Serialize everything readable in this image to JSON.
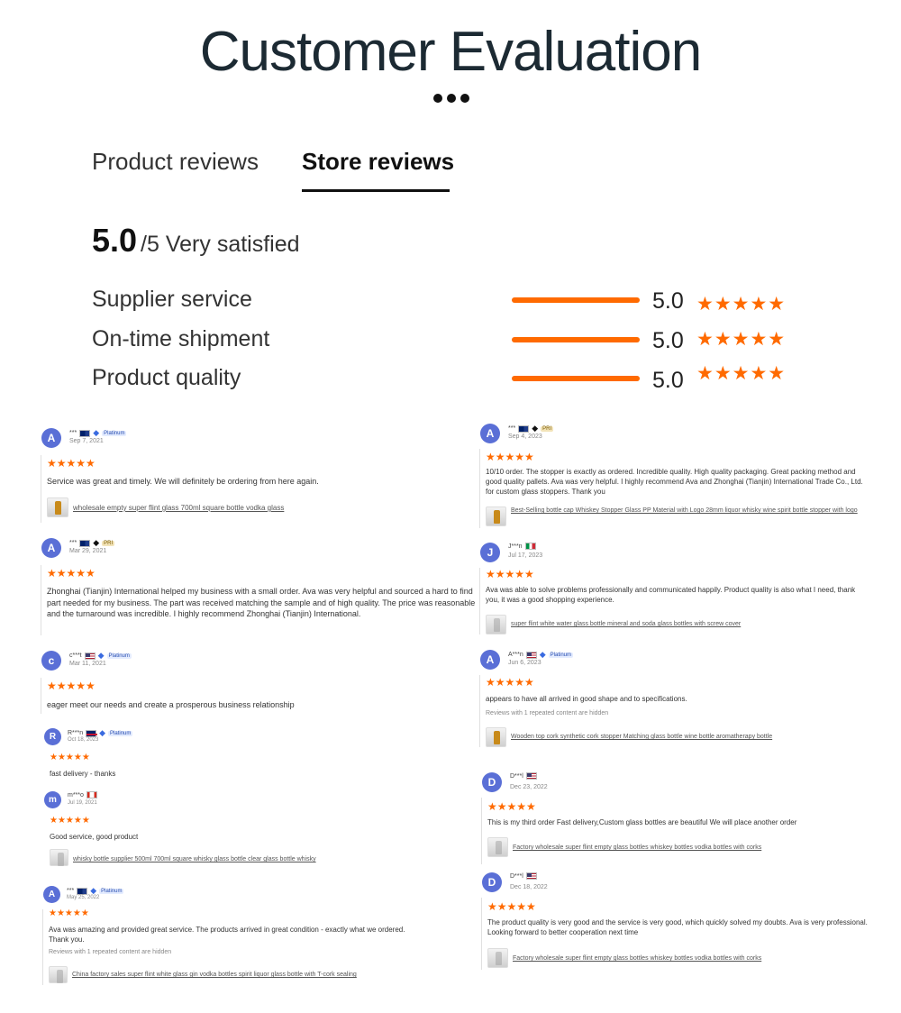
{
  "header": {
    "title": "Customer Evaluation"
  },
  "tabs": [
    {
      "label": "Product reviews"
    },
    {
      "label": "Store reviews"
    }
  ],
  "overall": {
    "score": "5.0",
    "suffix": "/5 Very satisfied"
  },
  "metrics": [
    {
      "label": "Supplier service",
      "value": "5.0",
      "fill_percent": 100,
      "stars": "★★★★★"
    },
    {
      "label": "On-time shipment",
      "value": "5.0",
      "fill_percent": 100,
      "stars": "★★★★★"
    },
    {
      "label": "Product quality",
      "value": "5.0",
      "fill_percent": 100,
      "stars": "★★★★★"
    }
  ],
  "colors": {
    "accent": "#ff6a00",
    "avatar": "#5a6fd6",
    "title": "#1c2a33"
  },
  "reviews_left": [
    {
      "initial": "A",
      "name": "***",
      "flag": "au",
      "badge": "Platinum",
      "date": "Sep 7, 2021",
      "stars": "★★★★★",
      "text": "Service was great and timely. We will definitely be ordering from here again.",
      "product": "wholesale empty super flint glass 700ml square bottle vodka glass"
    },
    {
      "initial": "A",
      "name": "***",
      "flag": "au",
      "badge": "PRI",
      "date": "Mar 29, 2021",
      "stars": "★★★★★",
      "text": "Zhonghai (Tianjin) International helped my business with a small order. Ava was very helpful and sourced a hard to find part needed for my business. The part was received matching the sample and of high quality. The price was reasonable and the turnaround was incredible. I highly recommend Zhonghai (Tianjin) International."
    },
    {
      "initial": "c",
      "name": "c***t",
      "flag": "us",
      "badge": "Platinum",
      "date": "Mar 11, 2021",
      "stars": "★★★★★",
      "text": "eager meet our needs and create a prosperous business relationship"
    },
    {
      "initial": "R",
      "name": "R***n",
      "flag": "gb",
      "badge": "Platinum",
      "date": "Oct 18, 2023",
      "stars": "★★★★★",
      "text": "fast delivery - thanks"
    },
    {
      "initial": "m",
      "name": "m***o",
      "flag": "ca",
      "badge": "",
      "date": "Jul 19, 2021",
      "stars": "★★★★★",
      "text": "Good service, good product",
      "product": "whisky bottle supplier 500ml 700ml square whisky glass bottle clear glass bottle whisky"
    },
    {
      "initial": "A",
      "name": "***",
      "flag": "au",
      "badge": "Platinum",
      "date": "May 25, 2022",
      "stars": "★★★★★",
      "text": "Ava was amazing and provided great service. The products arrived in great condition - exactly what we ordered. Thank you.",
      "hidden_note": "Reviews with 1 repeated content are hidden",
      "product": "China factory sales super flint white glass gin vodka bottles spirit liquor glass bottle with T-cork sealing"
    }
  ],
  "reviews_right": [
    {
      "initial": "A",
      "name": "***",
      "flag": "au",
      "badge": "PRI",
      "date": "Sep 4, 2023",
      "stars": "★★★★★",
      "text": "10/10 order. The stopper is exactly as ordered. Incredible quality. High quality packaging. Great packing method and good quality pallets. Ava was very helpful. I highly recommend Ava and Zhonghai (Tianjin) International Trade Co., Ltd. for custom glass stoppers. Thank you",
      "product": "Best-Selling bottle cap Whiskey Stopper Glass PP Material with Logo 28mm liquor whisky wine spirit bottle stopper with logo"
    },
    {
      "initial": "J",
      "name": "J***n",
      "flag": "it",
      "badge": "",
      "date": "Jul 17, 2023",
      "stars": "★★★★★",
      "text": "Ava was able to solve problems professionally and communicated happily. Product quality is also what I need, thank you, it was a good shopping experience.",
      "product": "super flint white water glass bottle mineral and soda glass bottles with screw cover"
    },
    {
      "initial": "A",
      "name": "A***n",
      "flag": "us",
      "badge": "Platinum",
      "date": "Jun 6, 2023",
      "stars": "★★★★★",
      "text": "appears to have all arrived in good shape and to specifications.",
      "hidden_note": "Reviews with 1 repeated content are hidden",
      "product": "Wooden top cork synthetic cork stopper Matching glass bottle wine bottle aromatherapy bottle"
    },
    {
      "initial": "D",
      "name": "D***l",
      "flag": "us",
      "badge": "",
      "date": "Dec 23, 2022",
      "stars": "★★★★★",
      "text": "This is my third order Fast delivery,Custom glass bottles are beautiful We will place another order",
      "product": "Factory wholesale super flint empty glass bottles whiskey bottles vodka bottles with corks"
    },
    {
      "initial": "D",
      "name": "D***l",
      "flag": "us",
      "badge": "",
      "date": "Dec 18, 2022",
      "stars": "★★★★★",
      "text": "The product quality is very good and the service is very good, which quickly solved my doubts. Ava is very professional. Looking forward to better cooperation next time",
      "product": "Factory wholesale super flint empty glass bottles whiskey bottles vodka bottles with corks"
    }
  ]
}
